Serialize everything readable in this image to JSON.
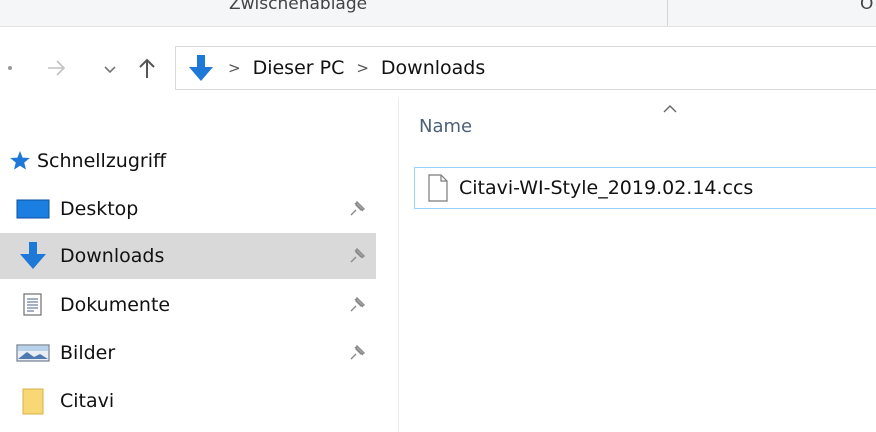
{
  "ribbon": {
    "group_label": "Zwischenablage",
    "next_group_fragment": "O"
  },
  "nav": {
    "back_icon": "back-arrow-icon",
    "forward_icon": "forward-arrow-icon",
    "recent_icon": "chevron-down-icon",
    "up_icon": "up-arrow-icon"
  },
  "address": {
    "location_icon": "downloads-arrow-icon",
    "crumbs": [
      "Dieser PC",
      "Downloads"
    ]
  },
  "sidebar": {
    "items": [
      {
        "label": "Schnellzugriff",
        "icon": "star-icon",
        "pinned": false,
        "selected": false
      },
      {
        "label": "Desktop",
        "icon": "desktop-icon",
        "pinned": true,
        "selected": false
      },
      {
        "label": "Downloads",
        "icon": "downloads-icon",
        "pinned": true,
        "selected": true
      },
      {
        "label": "Dokumente",
        "icon": "document-icon",
        "pinned": true,
        "selected": false
      },
      {
        "label": "Bilder",
        "icon": "pictures-icon",
        "pinned": true,
        "selected": false
      },
      {
        "label": "Citavi",
        "icon": "folder-icon",
        "pinned": false,
        "selected": false
      }
    ]
  },
  "content": {
    "column_header": "Name",
    "files": [
      {
        "name": "Citavi-WI-Style_2019.02.14.ccs",
        "icon": "file-icon"
      }
    ]
  },
  "colors": {
    "accent_blue": "#1e78d7",
    "selection_bg": "#d9d9d9",
    "row_border": "#99d1ff",
    "folder_yellow": "#f8d775"
  }
}
